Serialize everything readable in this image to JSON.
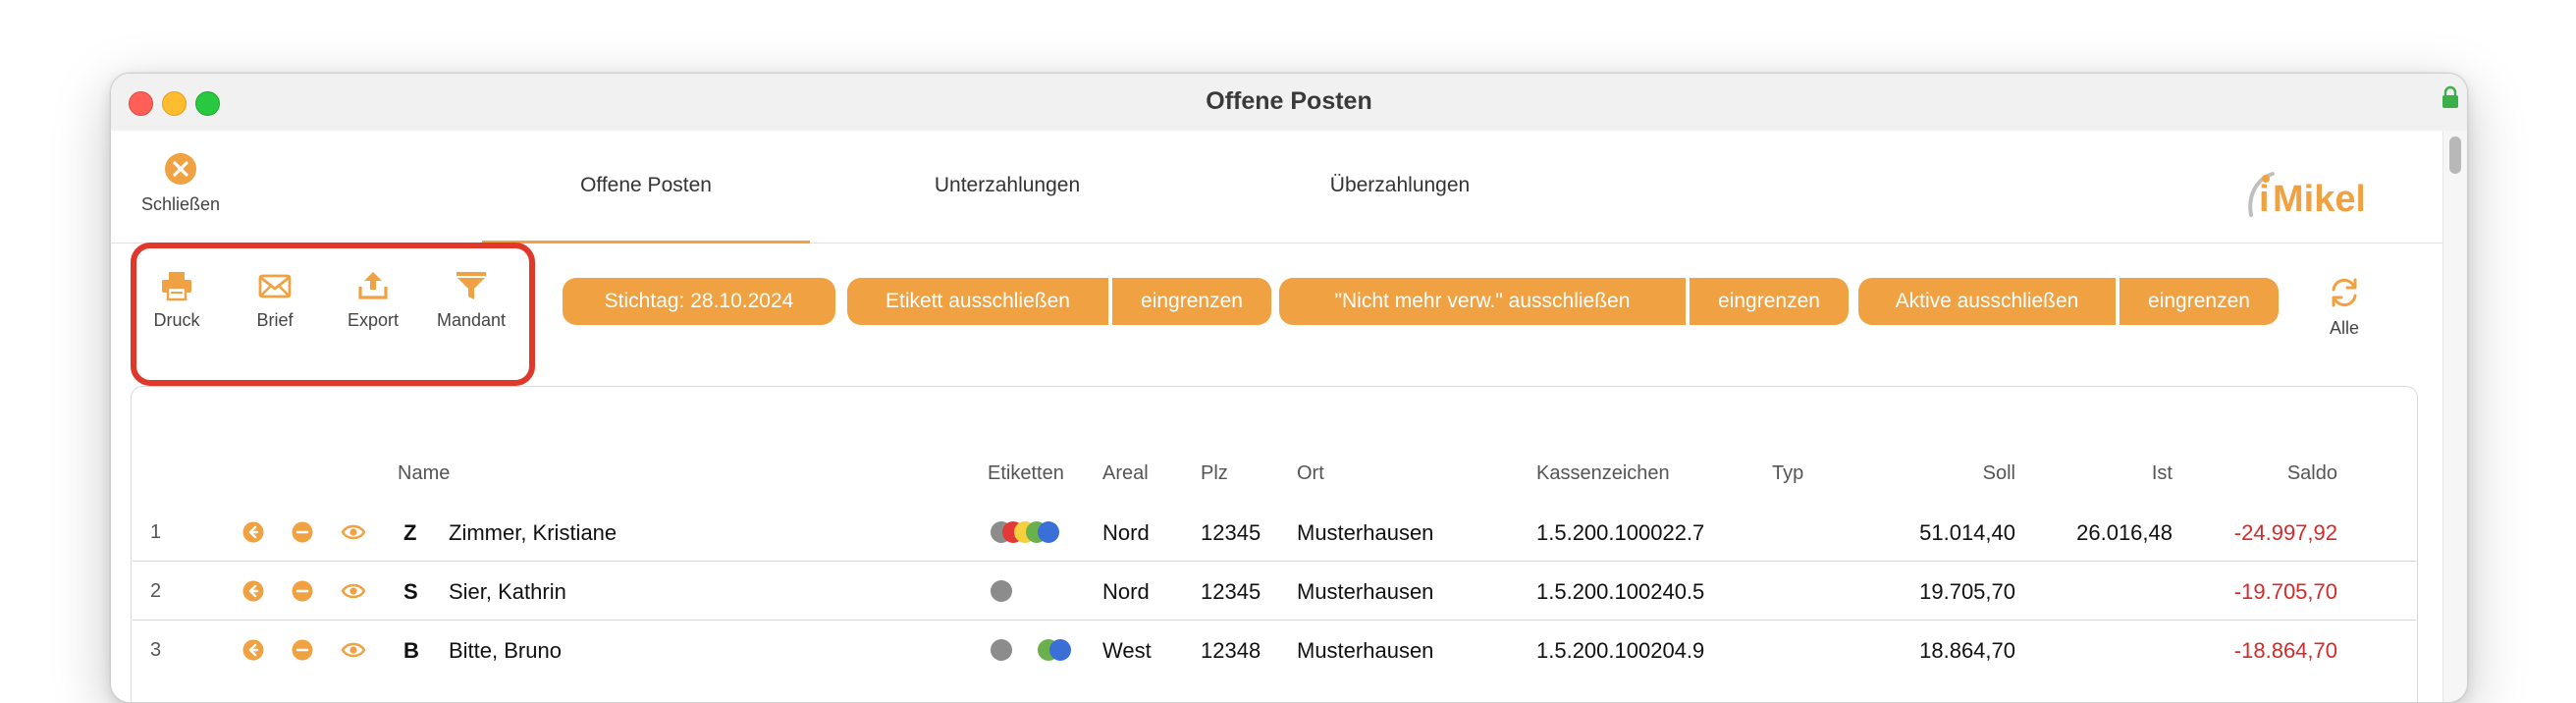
{
  "window": {
    "title": "Offene Posten"
  },
  "toolbar": {
    "close_label": "Schließen"
  },
  "tabs": [
    {
      "label": "Offene Posten",
      "active": true
    },
    {
      "label": "Unterzahlungen",
      "active": false
    },
    {
      "label": "Überzahlungen",
      "active": false
    }
  ],
  "logo": {
    "text": "iMikel"
  },
  "tools": [
    {
      "label": "Druck",
      "icon": "printer-icon"
    },
    {
      "label": "Brief",
      "icon": "envelope-icon"
    },
    {
      "label": "Export",
      "icon": "export-icon"
    },
    {
      "label": "Mandant",
      "icon": "filter-icon"
    }
  ],
  "filters": {
    "stichtag": "Stichtag: 28.10.2024",
    "etikett_ausschliessen": "Etikett ausschließen",
    "etikett_eingrenzen": "eingrenzen",
    "nicht_mehr_ausschliessen": "\"Nicht mehr verw.\" ausschließen",
    "nicht_mehr_eingrenzen": "eingrenzen",
    "aktive_ausschliessen": "Aktive ausschließen",
    "aktive_eingrenzen": "eingrenzen",
    "refresh_label": "Alle"
  },
  "table": {
    "headers": {
      "name": "Name",
      "etiketten": "Etiketten",
      "areal": "Areal",
      "plz": "Plz",
      "ort": "Ort",
      "kassenzeichen": "Kassenzeichen",
      "typ": "Typ",
      "soll": "Soll",
      "ist": "Ist",
      "saldo": "Saldo"
    },
    "rows": [
      {
        "num": "1",
        "letter": "Z",
        "name": "Zimmer, Kristiane",
        "areal": "Nord",
        "plz": "12345",
        "ort": "Musterhausen",
        "kassenzeichen": "1.5.200.100022.7",
        "typ": "",
        "soll": "51.014,40",
        "ist": "26.016,48",
        "saldo": "-24.997,92"
      },
      {
        "num": "2",
        "letter": "S",
        "name": "Sier, Kathrin",
        "areal": "Nord",
        "plz": "12345",
        "ort": "Musterhausen",
        "kassenzeichen": "1.5.200.100240.5",
        "typ": "",
        "soll": "19.705,70",
        "ist": "",
        "saldo": "-19.705,70"
      },
      {
        "num": "3",
        "letter": "B",
        "name": "Bitte, Bruno",
        "areal": "West",
        "plz": "12348",
        "ort": "Musterhausen",
        "kassenzeichen": "1.5.200.100204.9",
        "typ": "",
        "soll": "18.864,70",
        "ist": "",
        "saldo": "-18.864,70"
      }
    ]
  },
  "colors": {
    "accent": "#f0a141",
    "highlight": "#e0382a",
    "negative": "#d42a2a",
    "label_gray": "#8c8c8c",
    "label_red": "#e53935",
    "label_yellow": "#f4d03f",
    "label_green": "#6ab04c",
    "label_blue": "#3b6fd8"
  }
}
